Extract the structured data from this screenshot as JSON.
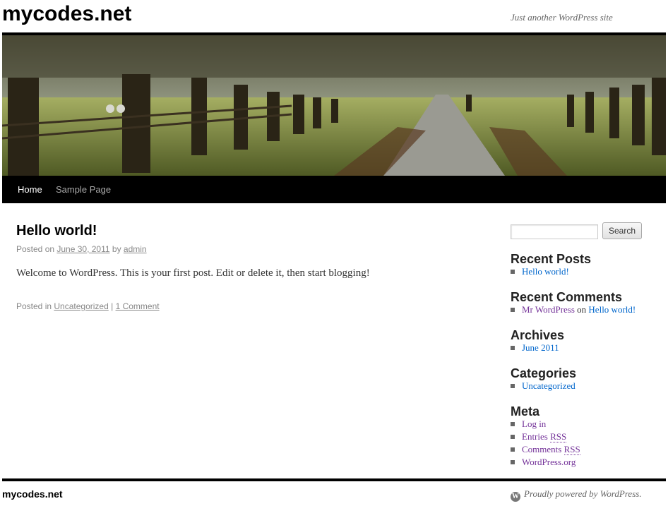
{
  "site": {
    "title": "mycodes.net",
    "description": "Just another WordPress site"
  },
  "nav": {
    "items": [
      {
        "label": "Home"
      },
      {
        "label": "Sample Page"
      }
    ]
  },
  "post": {
    "title": "Hello world!",
    "posted_on_prefix": "Posted on ",
    "date": "June 30, 2011",
    "by": " by ",
    "author": "admin",
    "content": "Welcome to WordPress. This is your first post. Edit or delete it, then start blogging!",
    "posted_in_prefix": "Posted in ",
    "category": "Uncategorized",
    "separator": " | ",
    "comments": "1 Comment"
  },
  "sidebar": {
    "search": {
      "value": "",
      "button": "Search"
    },
    "recent_posts": {
      "title": "Recent Posts",
      "items": [
        "Hello world!"
      ]
    },
    "recent_comments": {
      "title": "Recent Comments",
      "author": "Mr WordPress",
      "on": " on ",
      "post": "Hello world!"
    },
    "archives": {
      "title": "Archives",
      "items": [
        "June 2011"
      ]
    },
    "categories": {
      "title": "Categories",
      "items": [
        "Uncategorized"
      ]
    },
    "meta": {
      "title": "Meta",
      "log_in": "Log in",
      "entries": "Entries ",
      "comments": "Comments ",
      "rss": "RSS",
      "wordpress_org": "WordPress.org"
    }
  },
  "footer": {
    "title": "mycodes.net",
    "credit": "Proudly powered by WordPress."
  },
  "colors": {
    "link_blue": "#0066cc",
    "link_visited": "#743399",
    "nav_background": "#000000"
  },
  "icons": {
    "footer": "wordpress-logo-icon"
  }
}
